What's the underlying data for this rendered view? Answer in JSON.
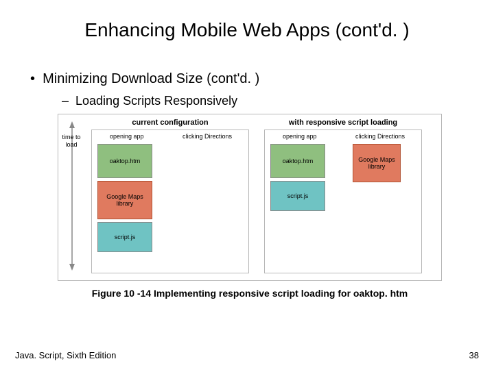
{
  "title": "Enhancing Mobile Web Apps (cont'd. )",
  "bullet1": "Minimizing Download Size (cont'd. )",
  "bullet2": "Loading Scripts Responsively",
  "axis_label": "time to load",
  "panels": {
    "left": {
      "title": "current configuration",
      "col1_label": "opening app",
      "col2_label": "clicking Directions",
      "box_oaktop": "oaktop.htm",
      "box_maps": "Google Maps library",
      "box_script": "script.js"
    },
    "right": {
      "title": "with responsive script loading",
      "col1_label": "opening app",
      "col2_label": "clicking Directions",
      "box_oaktop": "oaktop.htm",
      "box_script": "script.js",
      "box_maps": "Google Maps library"
    }
  },
  "caption": "Figure 10 -14 Implementing responsive script loading for oaktop. htm",
  "footer_left": "Java. Script, Sixth Edition",
  "footer_right": "38"
}
